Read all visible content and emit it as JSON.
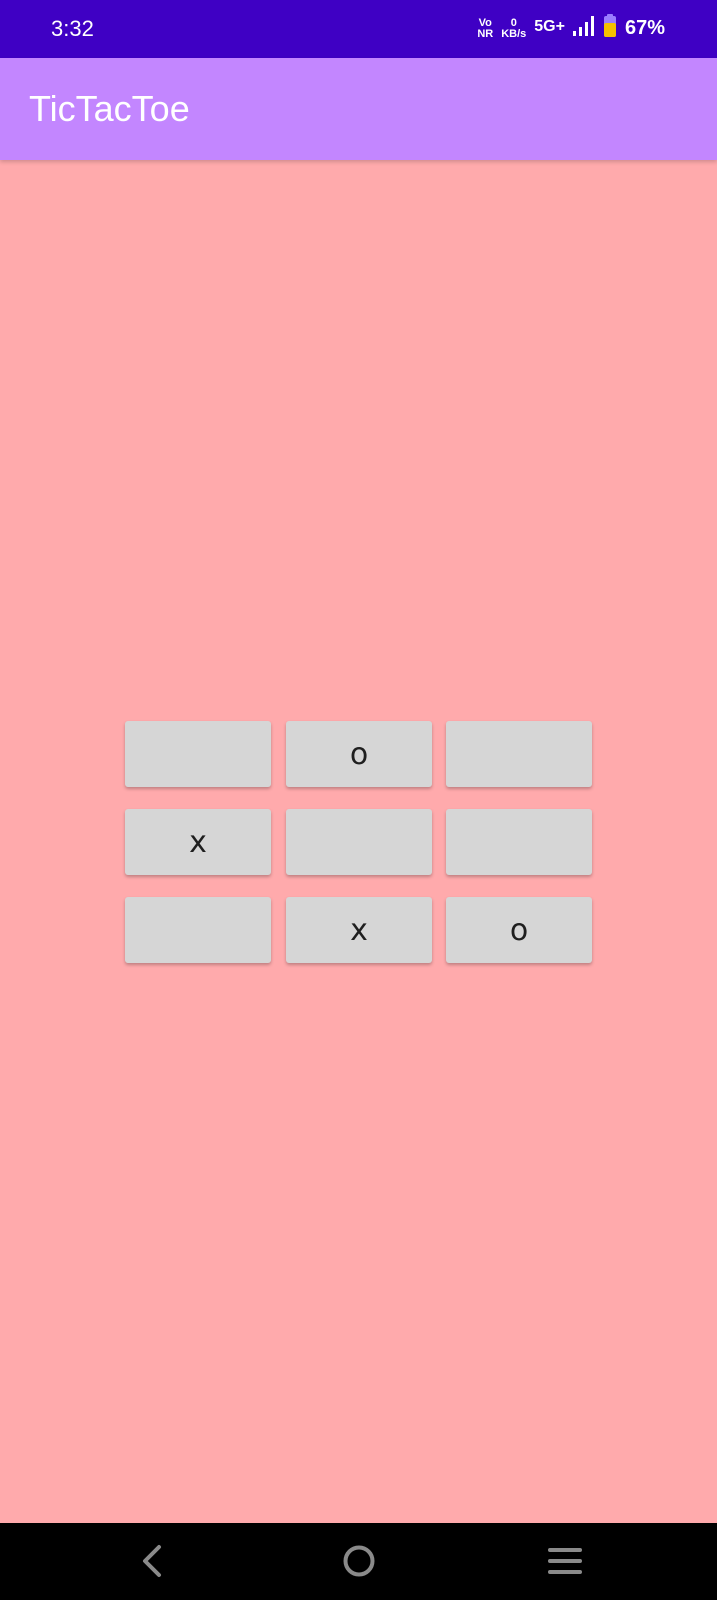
{
  "status_bar": {
    "time": "3:32",
    "volte_top": "Vo",
    "volte_bottom": "NR",
    "speed_value": "0",
    "speed_unit": "KB/s",
    "network": "5G+",
    "battery": "67%"
  },
  "app_bar": {
    "title": "TicTacToe"
  },
  "board": {
    "cells": [
      "",
      "o",
      "",
      "x",
      "",
      "",
      "",
      "x",
      "o"
    ]
  },
  "colors": {
    "status_bar": "#3F00C4",
    "app_bar": "#C386FF",
    "background": "#FFAAAC",
    "cell": "#D6D6D6",
    "battery_fill": "#F6C000"
  },
  "nav_bar": {
    "icons": [
      "back-icon",
      "home-icon",
      "recents-icon"
    ]
  }
}
